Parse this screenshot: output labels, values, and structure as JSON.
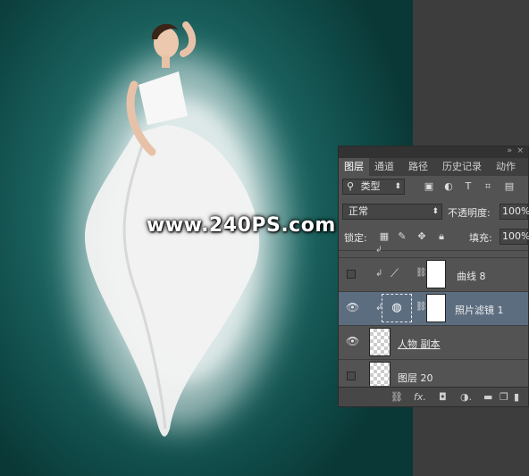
{
  "watermark": "www.240PS.com",
  "layers_panel": {
    "tabs": [
      {
        "label": "图层",
        "active": true
      },
      {
        "label": "通道",
        "active": false
      },
      {
        "label": "路径",
        "active": false
      },
      {
        "label": "历史记录",
        "active": false
      },
      {
        "label": "动作",
        "active": false
      }
    ],
    "filter_kind": "类型",
    "blend_mode": "正常",
    "opacity_label": "不透明度:",
    "opacity_value": "100%",
    "lock_label": "锁定:",
    "fill_label": "填充:",
    "fill_value": "100%",
    "layers": [
      {
        "name": "曲线 8",
        "visible": false,
        "type": "curves-adjustment",
        "clipped": true
      },
      {
        "name": "照片滤镜 1",
        "visible": true,
        "type": "photo-filter-adjustment",
        "clipped": true,
        "selected": true
      },
      {
        "name": "人物 副本",
        "visible": true,
        "type": "pixel"
      },
      {
        "name": "图层 20",
        "visible": false,
        "type": "pixel"
      }
    ]
  },
  "colors": {
    "canvas_bg": "#1f6a66",
    "panel_bg": "#535353",
    "selected_layer": "#5d6d80"
  }
}
